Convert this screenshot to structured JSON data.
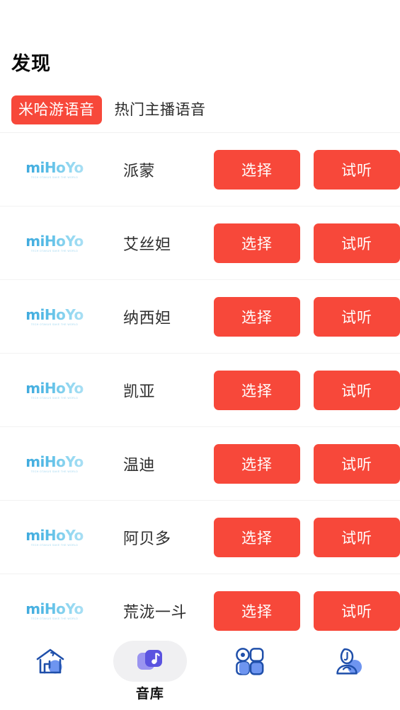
{
  "page": {
    "title": "发现"
  },
  "tabs": [
    {
      "label": "米哈游语音",
      "active": true
    },
    {
      "label": "热门主播语音",
      "active": false
    }
  ],
  "logo": {
    "word_mi": "mi",
    "word_hoyo": "HoYo",
    "tagline": "TECH OTAKUS SAVE THE WORLD"
  },
  "actions": {
    "select_label": "选择",
    "preview_label": "试听"
  },
  "list": [
    {
      "name": "派蒙",
      "brand": "miHoYo"
    },
    {
      "name": "艾丝妲",
      "brand": "miHoYo"
    },
    {
      "name": "纳西妲",
      "brand": "miHoYo"
    },
    {
      "name": "凯亚",
      "brand": "miHoYo"
    },
    {
      "name": "温迪",
      "brand": "miHoYo"
    },
    {
      "name": "阿贝多",
      "brand": "miHoYo"
    },
    {
      "name": "荒泷一斗",
      "brand": "miHoYo"
    }
  ],
  "bottom_nav": [
    {
      "icon": "home-icon",
      "label": "",
      "active": false
    },
    {
      "icon": "music-library-icon",
      "label": "音库",
      "active": true
    },
    {
      "icon": "grid-apps-icon",
      "label": "",
      "active": false
    },
    {
      "icon": "profile-icon",
      "label": "",
      "active": false
    }
  ],
  "colors": {
    "accent_red": "#f7483a",
    "logo_blue_dark": "#3ea9dd",
    "logo_blue_light": "#a9dff4",
    "nav_icon_outline": "#1f4faa",
    "nav_icon_fill": "#6e95f0",
    "nav_active_purple": "#5b53e0",
    "nav_active_purple_light": "#9a94f0",
    "divider": "#f2f2f2"
  }
}
